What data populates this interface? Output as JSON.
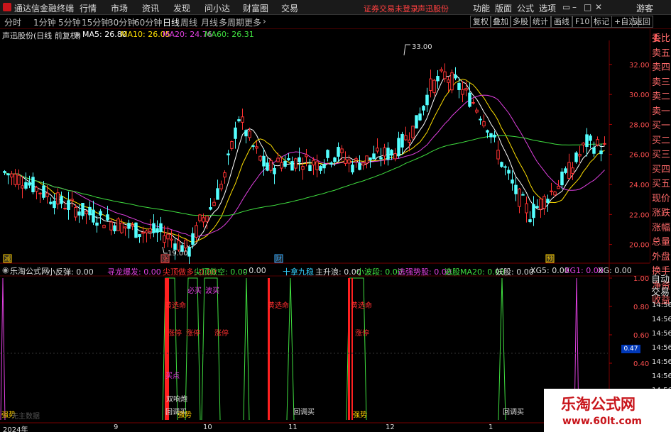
{
  "window": {
    "app_name": "通达信金融终端",
    "menu": [
      "行情",
      "市场",
      "资讯",
      "发现",
      "问小达",
      "财富圈",
      "交易"
    ],
    "status": "证券交易未登录",
    "stock_name_status": "声迅股份",
    "right_menu": [
      "功能",
      "版面",
      "公式",
      "选项"
    ],
    "user": "游客"
  },
  "toolbar": {
    "periods": [
      "分时",
      "1分钟",
      "5分钟",
      "15分钟",
      "30分钟",
      "60分钟",
      "日线",
      "周线",
      "月线",
      "多周期",
      "更多"
    ],
    "active_period": "日线",
    "right_buttons": [
      "复权",
      "叠加",
      "多股",
      "统计",
      "画线",
      "F10",
      "标记",
      "+自选",
      "返回"
    ]
  },
  "main_chart": {
    "title": "声迅股份(日线 前复权)",
    "ma": [
      {
        "label": "MA5: 26.80",
        "color": "#ffffff"
      },
      {
        "label": "MA10: 26.05",
        "color": "#ffe000"
      },
      {
        "label": "MA20: 24.76",
        "color": "#e040e0"
      },
      {
        "label": "MA60: 26.31",
        "color": "#40e040"
      }
    ],
    "high_label": "33.00",
    "low_label": "19.00",
    "y_ticks": [
      "32.00",
      "30.00",
      "28.00",
      "26.00",
      "24.00",
      "22.00",
      "20.00"
    ],
    "events": [
      {
        "label": "减",
        "color": "#ffd000"
      },
      {
        "label": "涨",
        "color": "#ff5050"
      },
      {
        "label": "财",
        "color": "#33aaff"
      },
      {
        "label": "预",
        "color": "#ffd000"
      }
    ]
  },
  "sidebar": {
    "header": "L",
    "items": [
      {
        "label": "委比",
        "color": "red"
      },
      {
        "label": "卖五",
        "color": "red"
      },
      {
        "label": "卖四",
        "color": "red"
      },
      {
        "label": "卖三",
        "color": "red"
      },
      {
        "label": "卖二",
        "color": "red"
      },
      {
        "label": "卖一",
        "color": "red"
      },
      {
        "label": "买一",
        "color": "red"
      },
      {
        "label": "买二",
        "color": "red"
      },
      {
        "label": "买三",
        "color": "red"
      },
      {
        "label": "买四",
        "color": "red"
      },
      {
        "label": "买五",
        "color": "red"
      },
      {
        "label": "现价",
        "color": "red"
      },
      {
        "label": "涨跌",
        "color": "red"
      },
      {
        "label": "涨幅",
        "color": "red"
      },
      {
        "label": "总量",
        "color": "red"
      },
      {
        "label": "外盘",
        "color": "red"
      },
      {
        "label": "换手",
        "color": "red"
      },
      {
        "label": "净资",
        "color": "red"
      },
      {
        "label": "收益",
        "color": "red"
      }
    ]
  },
  "indicator": {
    "name": "乐淘公式网",
    "items": [
      {
        "label": "小反弹: 0.00",
        "color": "#dddddd"
      },
      {
        "label": "寻龙爆发: 0.00",
        "color": "#e040e0"
      },
      {
        "label": "尖顶做多: 0.00",
        "color": "#ff3030"
      },
      {
        "label": "尖顶做空: 0.00",
        "color": "#40e040"
      },
      {
        "label": ": 0.00",
        "color": "#dddddd"
      },
      {
        "label": "十拿九稳",
        "color": "#33d0ff"
      },
      {
        "label": "主升浪: 0.00",
        "color": "#dddddd"
      },
      {
        "label": "小波段: 0.00",
        "color": "#40e040"
      },
      {
        "label": "选强势股: 0.00",
        "color": "#e040e0"
      },
      {
        "label": "选股MA20: 0.00",
        "color": "#40e040"
      },
      {
        "label": "妖股: 0.00",
        "color": "#dddddd"
      },
      {
        "label": "XG5: 0.00",
        "color": "#dddddd"
      },
      {
        "label": "XG1: 0.00",
        "color": "#e040e0"
      },
      {
        "label": "XG: 0.00",
        "color": "#dddddd"
      }
    ],
    "y_ticks": [
      "1.00",
      "0.80",
      "0.60",
      "0.40",
      "0.20"
    ],
    "current_value": "0.47",
    "labels": {
      "strong_left": "强势",
      "no_data": "无主数据",
      "pullback_buy": "回调买",
      "strong": "强势",
      "kill_buy": "必买",
      "wave_buy": "波买",
      "fate": "黄选命",
      "buy_point": "买点",
      "raise": "涨停",
      "rebound": "双响炮"
    }
  },
  "sidebar2": {
    "items": [
      "自动",
      "交易"
    ],
    "times": [
      "14:56",
      "14:56",
      "14:56",
      "14:56",
      "14:56",
      "14:56",
      "14:56",
      "14:56"
    ]
  },
  "x_axis": [
    "2024年",
    "9",
    "10",
    "11",
    "12",
    "1"
  ],
  "watermark": {
    "title": "乐淘公式网",
    "url": "www.60lt.com"
  }
}
